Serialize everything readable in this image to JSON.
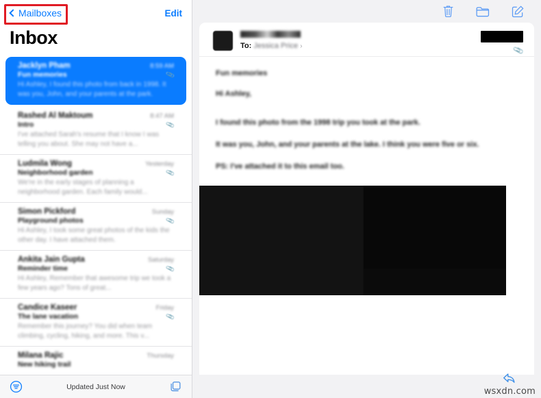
{
  "sidebar": {
    "back_label": "Mailboxes",
    "edit_label": "Edit",
    "title": "Inbox",
    "status_text": "Updated Just Now",
    "filter_icon": "filter-icon",
    "compose_icon": "layers-compose-icon",
    "back_icon": "chevron-left-icon",
    "messages": [
      {
        "sender": "Jacklyn Pham",
        "date": "8:59 AM",
        "subject": "Fun memories",
        "preview": "Hi Ashley, I found this photo from back in 1998. It was you, John, and your parents at the park.",
        "selected": true,
        "has_attachment": true
      },
      {
        "sender": "Rashed Al Maktoum",
        "date": "8:47 AM",
        "subject": "Intro",
        "preview": "I've attached Sarah's resume that I know I was telling you about. She may not have a...",
        "selected": false,
        "has_attachment": true
      },
      {
        "sender": "Ludmila Wong",
        "date": "Yesterday",
        "subject": "Neighborhood garden",
        "preview": "We're in the early stages of planning a neighborhood garden. Each family would...",
        "selected": false,
        "has_attachment": true
      },
      {
        "sender": "Simon Pickford",
        "date": "Sunday",
        "subject": "Playground photos",
        "preview": "Hi Ashley, I took some great photos of the kids the other day. I have attached them.",
        "selected": false,
        "has_attachment": true
      },
      {
        "sender": "Ankita Jain Gupta",
        "date": "Saturday",
        "subject": "Reminder time",
        "preview": "Hi Ashley, Remember that awesome trip we took a few years ago? Tons of great...",
        "selected": false,
        "has_attachment": true
      },
      {
        "sender": "Candice Kaseer",
        "date": "Friday",
        "subject": "The lane vacation",
        "preview": "Remember this journey? You did when team climbing, cycling, hiking, and more. This v...",
        "selected": false,
        "has_attachment": true
      },
      {
        "sender": "Milana Rajic",
        "date": "Thursday",
        "subject": "New hiking trail",
        "preview": "",
        "selected": false,
        "has_attachment": false
      }
    ]
  },
  "detail": {
    "toolbar": {
      "trash_icon": "trash-icon",
      "folder_icon": "folder-icon",
      "compose_icon": "compose-icon"
    },
    "header": {
      "to_label": "To:",
      "to_name": "Jessica Price",
      "to_chevron": "›",
      "attachment_icon": "paperclip-icon",
      "avatar_icon": "avatar"
    },
    "body_lines": [
      "Fun memories",
      "Hi Ashley,",
      "I found this photo from the 1998 trip you took at the park.",
      "It was you, John, and your parents at the lake. I think you were five or six.",
      "PS: I've attached it to this email too.",
      ""
    ],
    "reply_icon": "reply-arrow-icon",
    "watermark": "wsxdn.com"
  },
  "colors": {
    "accent": "#0a7cff",
    "highlight": "#e01b24",
    "selected_row_bg": "#0a7cff",
    "panel_bg": "#f2f2f4"
  }
}
